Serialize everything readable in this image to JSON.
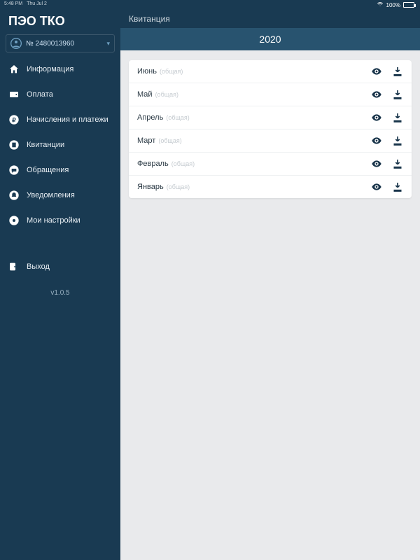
{
  "statusbar": {
    "time": "5:48 PM",
    "date": "Thu Jul 2",
    "battery": "100%"
  },
  "app": {
    "title": "ПЭО ТКО"
  },
  "account": {
    "number": "№ 2480013960"
  },
  "nav": {
    "info": "Информация",
    "payment": "Оплата",
    "charges": "Начисления и платежи",
    "receipts": "Квитанции",
    "requests": "Обращения",
    "notifications": "Уведомления",
    "settings": "Мои настройки",
    "exit": "Выход"
  },
  "version": "v1.0.5",
  "header": {
    "title": "Квитанция",
    "year": "2020"
  },
  "type_label": "(общая)",
  "months": [
    {
      "name": "Июнь"
    },
    {
      "name": "Май"
    },
    {
      "name": "Апрель"
    },
    {
      "name": "Март"
    },
    {
      "name": "Февраль"
    },
    {
      "name": "Январь"
    }
  ]
}
